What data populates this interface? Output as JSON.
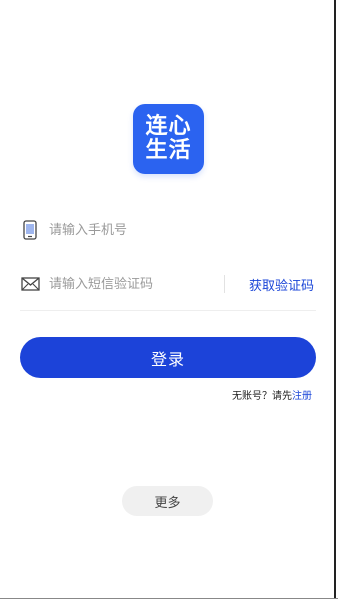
{
  "logo": {
    "text": "连心生活",
    "color": "#2b63f0"
  },
  "phone_field": {
    "icon": "phone-icon",
    "placeholder": "请输入手机号",
    "value": ""
  },
  "code_field": {
    "icon": "mail-icon",
    "placeholder": "请输入短信验证码",
    "value": "",
    "get_code_label": "获取验证码"
  },
  "login_button": {
    "label": "登录",
    "color": "#1c43d9"
  },
  "register": {
    "prompt": "无账号？请先",
    "link_label": "注册",
    "link_color": "#1b46d8"
  },
  "more_button": {
    "label": "更多"
  }
}
